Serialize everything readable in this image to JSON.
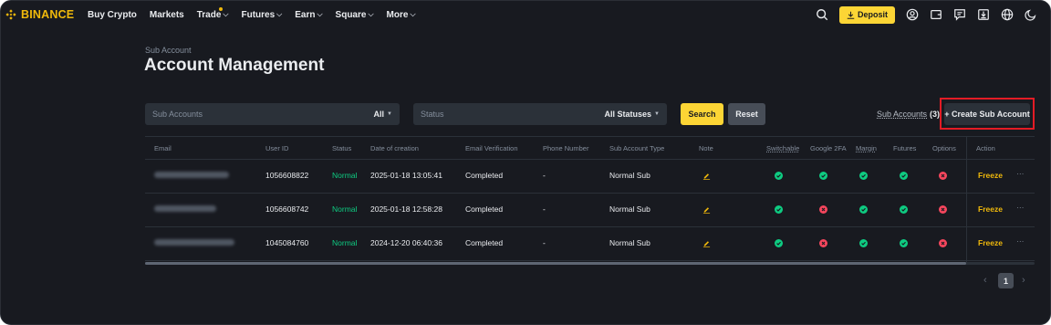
{
  "nav": {
    "brand": "BINANCE",
    "items": [
      {
        "label": "Buy Crypto",
        "chevron": false,
        "dot": false
      },
      {
        "label": "Markets",
        "chevron": false,
        "dot": false
      },
      {
        "label": "Trade",
        "chevron": true,
        "dot": true
      },
      {
        "label": "Futures",
        "chevron": true,
        "dot": false
      },
      {
        "label": "Earn",
        "chevron": true,
        "dot": false
      },
      {
        "label": "Square",
        "chevron": true,
        "dot": false
      },
      {
        "label": "More",
        "chevron": true,
        "dot": false
      }
    ],
    "deposit_label": "Deposit",
    "icons": [
      "search-icon",
      "user-icon",
      "wallet-icon",
      "message-icon",
      "download-icon",
      "globe-icon",
      "theme-icon"
    ]
  },
  "header": {
    "breadcrumb": "Sub Account",
    "title": "Account Management"
  },
  "filters": {
    "sub_accounts_placeholder": "Sub Accounts",
    "sub_accounts_value": "All",
    "status_placeholder": "Status",
    "status_value": "All Statuses",
    "search_label": "Search",
    "reset_label": "Reset",
    "sub_accounts_link": "Sub Accounts",
    "sub_accounts_count": "(3)",
    "create_label": "+ Create Sub Account"
  },
  "table": {
    "headers": {
      "email": "Email",
      "user_id": "User ID",
      "status": "Status",
      "date": "Date of creation",
      "email_verif": "Email Verification",
      "phone": "Phone Number",
      "type": "Sub Account Type",
      "note": "Note",
      "switchable": "Switchable",
      "google2fa": "Google 2FA",
      "margin": "Margin",
      "futures": "Futures",
      "options": "Options",
      "action": "Action"
    },
    "rows": [
      {
        "user_id": "1056608822",
        "status": "Normal",
        "date": "2025-01-18 13:05:41",
        "email_verif": "Completed",
        "phone": "-",
        "type": "Normal Sub",
        "switchable": true,
        "google2fa": true,
        "margin": true,
        "futures": true,
        "options": false,
        "action": "Freeze",
        "more": "···"
      },
      {
        "user_id": "1056608742",
        "status": "Normal",
        "date": "2025-01-18 12:58:28",
        "email_verif": "Completed",
        "phone": "-",
        "type": "Normal Sub",
        "switchable": true,
        "google2fa": false,
        "margin": true,
        "futures": true,
        "options": false,
        "action": "Freeze",
        "more": "···"
      },
      {
        "user_id": "1045084760",
        "status": "Normal",
        "date": "2024-12-20 06:40:36",
        "email_verif": "Completed",
        "phone": "-",
        "type": "Normal Sub",
        "switchable": true,
        "google2fa": false,
        "margin": true,
        "futures": true,
        "options": false,
        "action": "Freeze",
        "more": "···"
      }
    ]
  },
  "pagination": {
    "prev": "‹",
    "current": "1",
    "next": "›"
  },
  "colors": {
    "background": "#181a20",
    "accent": "#fcd535",
    "success": "#0ecb81",
    "danger": "#f6465d",
    "highlight_box": "#e31c25"
  }
}
